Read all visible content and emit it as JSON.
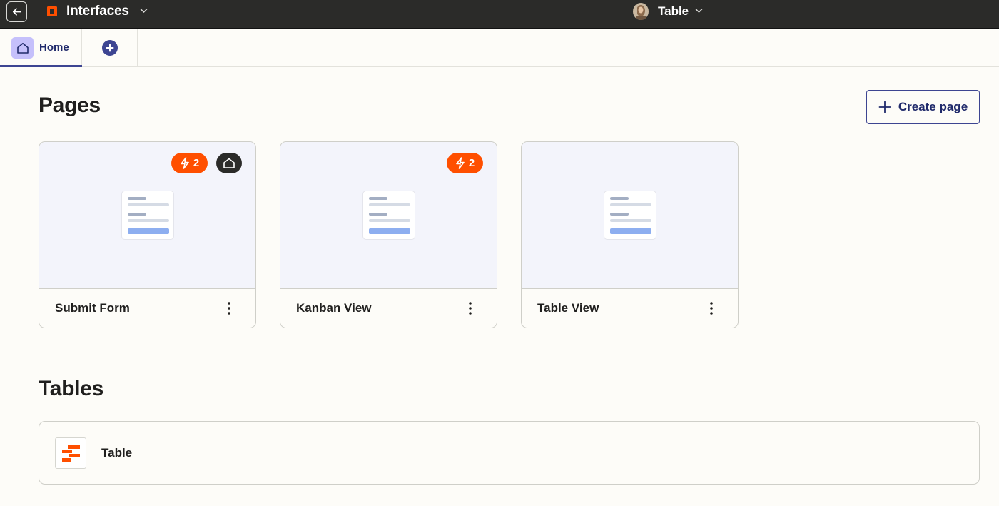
{
  "topbar": {
    "back_icon": "arrow-left-icon",
    "app_title": "Interfaces",
    "brand_color": "#ff4f00",
    "current_table": "Table"
  },
  "tabs": [
    {
      "label": "Home",
      "icon": "home-icon",
      "active": true
    },
    {
      "icon": "plus-circle-icon",
      "label": ""
    }
  ],
  "pages_section": {
    "title": "Pages",
    "create_button": "Create page",
    "cards": [
      {
        "name": "Submit Form",
        "automation_count": "2",
        "is_home": true
      },
      {
        "name": "Kanban View",
        "automation_count": "2",
        "is_home": false
      },
      {
        "name": "Table View",
        "automation_count": "",
        "is_home": false
      }
    ]
  },
  "tables_section": {
    "title": "Tables",
    "items": [
      {
        "name": "Table",
        "icon": "table-icon"
      }
    ]
  },
  "colors": {
    "accent": "#3d4592",
    "badge": "#ff4f00",
    "topbar": "#2b2b29"
  }
}
